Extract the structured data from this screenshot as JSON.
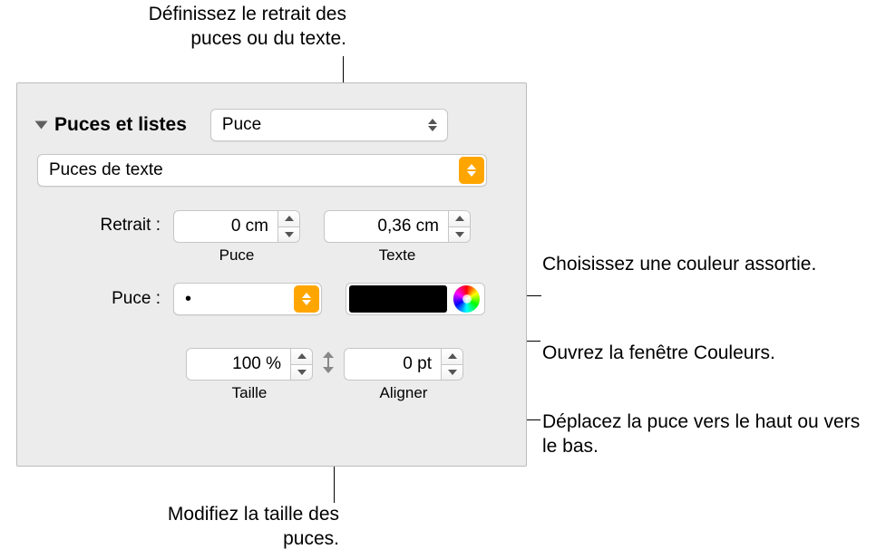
{
  "callouts": {
    "top": "Définissez le retrait des puces ou du texte.",
    "color_swatch": "Choisissez une couleur assortie.",
    "color_wheel": "Ouvrez la fenêtre Couleurs.",
    "align": "Déplacez la puce vers le haut ou vers le bas.",
    "size": "Modifiez la taille des puces."
  },
  "panel": {
    "section_title": "Puces et listes",
    "list_style_select": "Puce",
    "bullet_type_select": "Puces de texte",
    "indent_label": "Retrait :",
    "indent_bullet_value": "0 cm",
    "indent_bullet_sub": "Puce",
    "indent_text_value": "0,36 cm",
    "indent_text_sub": "Texte",
    "bullet_label": "Puce :",
    "bullet_char_value": "•",
    "size_value": "100 %",
    "size_sub": "Taille",
    "align_value": "0 pt",
    "align_sub": "Aligner"
  }
}
